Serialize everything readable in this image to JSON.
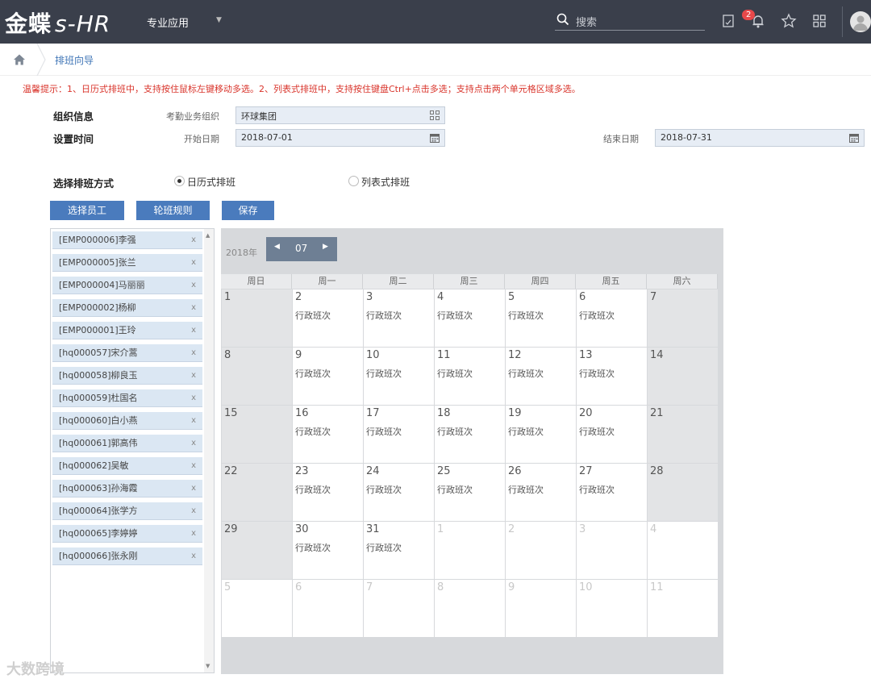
{
  "topbar": {
    "logo_cn": "金蝶",
    "logo_en": "s-HR",
    "app_menu": "专业应用",
    "search_placeholder": "搜索",
    "notification_count": "2"
  },
  "breadcrumb": {
    "current": "排班向导"
  },
  "tip": "温馨提示：1、日历式排班中，支持按住鼠标左键移动多选。2、列表式排班中，支持按住键盘Ctrl+点击多选；支持点击两个单元格区域多选。",
  "form": {
    "org_section": "组织信息",
    "org_label": "考勤业务组织",
    "org_value": "环球集团",
    "time_section": "设置时间",
    "start_label": "开始日期",
    "start_value": "2018-07-01",
    "end_label": "结束日期",
    "end_value": "2018-07-31",
    "mode_section": "选择排班方式",
    "mode_calendar": "日历式排班",
    "mode_list": "列表式排班"
  },
  "buttons": {
    "select_staff": "选择员工",
    "rotation_rule": "轮班规则",
    "save": "保存"
  },
  "employees": [
    "[EMP000006]李强",
    "[EMP000005]张兰",
    "[EMP000004]马丽丽",
    "[EMP000002]杨柳",
    "[EMP000001]王玲",
    "[hq000057]宋介蒿",
    "[hq000058]柳良玉",
    "[hq000059]杜国名",
    "[hq000060]白小燕",
    "[hq000061]郭高伟",
    "[hq000062]吴敏",
    "[hq000063]孙海霞",
    "[hq000064]张学方",
    "[hq000065]李婷婷",
    "[hq000066]张永刚"
  ],
  "remove_mark": "x",
  "calendar": {
    "year": "2018年",
    "month": "07",
    "weekdays": [
      "周日",
      "周一",
      "周二",
      "周三",
      "周四",
      "周五",
      "周六"
    ],
    "shift_name": "行政班次",
    "weeks": [
      [
        {
          "d": "1",
          "s": "",
          "o": false
        },
        {
          "d": "2",
          "s": "行政班次",
          "o": false
        },
        {
          "d": "3",
          "s": "行政班次",
          "o": false
        },
        {
          "d": "4",
          "s": "行政班次",
          "o": false
        },
        {
          "d": "5",
          "s": "行政班次",
          "o": false
        },
        {
          "d": "6",
          "s": "行政班次",
          "o": false
        },
        {
          "d": "7",
          "s": "",
          "o": false
        }
      ],
      [
        {
          "d": "8",
          "s": "",
          "o": false
        },
        {
          "d": "9",
          "s": "行政班次",
          "o": false
        },
        {
          "d": "10",
          "s": "行政班次",
          "o": false
        },
        {
          "d": "11",
          "s": "行政班次",
          "o": false
        },
        {
          "d": "12",
          "s": "行政班次",
          "o": false
        },
        {
          "d": "13",
          "s": "行政班次",
          "o": false
        },
        {
          "d": "14",
          "s": "",
          "o": false
        }
      ],
      [
        {
          "d": "15",
          "s": "",
          "o": false
        },
        {
          "d": "16",
          "s": "行政班次",
          "o": false
        },
        {
          "d": "17",
          "s": "行政班次",
          "o": false
        },
        {
          "d": "18",
          "s": "行政班次",
          "o": false
        },
        {
          "d": "19",
          "s": "行政班次",
          "o": false
        },
        {
          "d": "20",
          "s": "行政班次",
          "o": false
        },
        {
          "d": "21",
          "s": "",
          "o": false
        }
      ],
      [
        {
          "d": "22",
          "s": "",
          "o": false
        },
        {
          "d": "23",
          "s": "行政班次",
          "o": false
        },
        {
          "d": "24",
          "s": "行政班次",
          "o": false
        },
        {
          "d": "25",
          "s": "行政班次",
          "o": false
        },
        {
          "d": "26",
          "s": "行政班次",
          "o": false
        },
        {
          "d": "27",
          "s": "行政班次",
          "o": false
        },
        {
          "d": "28",
          "s": "",
          "o": false
        }
      ],
      [
        {
          "d": "29",
          "s": "",
          "o": false
        },
        {
          "d": "30",
          "s": "行政班次",
          "o": false
        },
        {
          "d": "31",
          "s": "行政班次",
          "o": false
        },
        {
          "d": "1",
          "s": "",
          "o": true
        },
        {
          "d": "2",
          "s": "",
          "o": true
        },
        {
          "d": "3",
          "s": "",
          "o": true
        },
        {
          "d": "4",
          "s": "",
          "o": true
        }
      ],
      [
        {
          "d": "5",
          "s": "",
          "o": true
        },
        {
          "d": "6",
          "s": "",
          "o": true
        },
        {
          "d": "7",
          "s": "",
          "o": true
        },
        {
          "d": "8",
          "s": "",
          "o": true
        },
        {
          "d": "9",
          "s": "",
          "o": true
        },
        {
          "d": "10",
          "s": "",
          "o": true
        },
        {
          "d": "11",
          "s": "",
          "o": true
        }
      ]
    ]
  },
  "watermark": "大数跨境",
  "colors": {
    "topbar": "#3a3f4b",
    "accent": "#4a7bbd",
    "tip": "#d9342b"
  }
}
